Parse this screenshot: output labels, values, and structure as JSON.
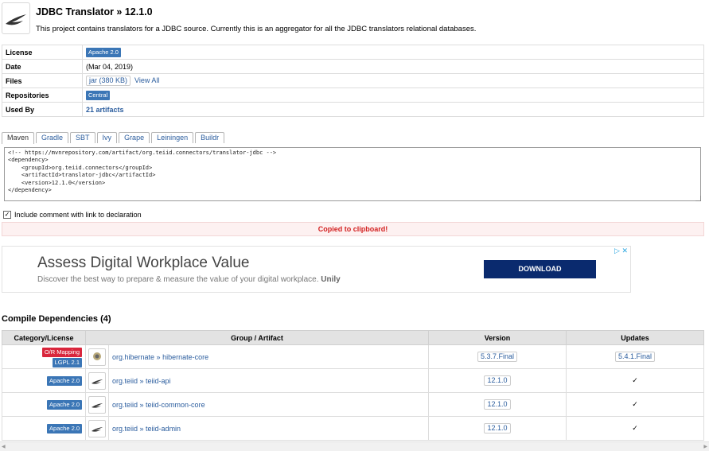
{
  "header": {
    "title": "JDBC Translator » 12.1.0",
    "description": "This project contains translators for a JDBC source. Currently this is an aggregator for all the JDBC translators relational databases."
  },
  "info": {
    "license_label": "License",
    "license_value": "Apache 2.0",
    "date_label": "Date",
    "date_value": "(Mar 04, 2019)",
    "files_label": "Files",
    "files_jar": "jar (380 KB)",
    "files_viewall": "View All",
    "repos_label": "Repositories",
    "repos_value": "Central",
    "usedby_label": "Used By",
    "usedby_value": "21 artifacts"
  },
  "tabs": [
    "Maven",
    "Gradle",
    "SBT",
    "Ivy",
    "Grape",
    "Leiningen",
    "Buildr"
  ],
  "code": "<!-- https://mvnrepository.com/artifact/org.teiid.connectors/translator-jdbc -->\n<dependency>\n    <groupId>org.teiid.connectors</groupId>\n    <artifactId>translator-jdbc</artifactId>\n    <version>12.1.0</version>\n</dependency>",
  "include_comment": "Include comment with link to declaration",
  "copied": "Copied to clipboard!",
  "ad": {
    "title": "Assess Digital Workplace Value",
    "subtitle": "Discover the best way to prepare & measure the value of your digital workplace.",
    "brand": "Unily",
    "button": "DOWNLOAD"
  },
  "deps": {
    "title": "Compile Dependencies (4)",
    "headers": [
      "Category/License",
      "Group / Artifact",
      "Version",
      "Updates"
    ],
    "rows": [
      {
        "badge1": "O/R Mapping",
        "badge2": "LGPL 2.1",
        "group": "org.hibernate",
        "sep": " » ",
        "artifact": "hibernate-core",
        "version": "5.3.7.Final",
        "update": "5.4.1.Final"
      },
      {
        "badge2": "Apache 2.0",
        "group": "org.teiid",
        "sep": " » ",
        "artifact": "teiid-api",
        "version": "12.1.0",
        "update": "✓"
      },
      {
        "badge2": "Apache 2.0",
        "group": "org.teiid",
        "sep": " » ",
        "artifact": "teiid-common-core",
        "version": "12.1.0",
        "update": "✓"
      },
      {
        "badge2": "Apache 2.0",
        "group": "org.teiid",
        "sep": " » ",
        "artifact": "teiid-admin",
        "version": "12.1.0",
        "update": "✓"
      }
    ]
  },
  "colors": {
    "badge_blue": "#3b76b6",
    "badge_red": "#d9263c",
    "link": "#2b5d9e",
    "copied": "#d32020",
    "ad_button": "#0a2a6e"
  }
}
